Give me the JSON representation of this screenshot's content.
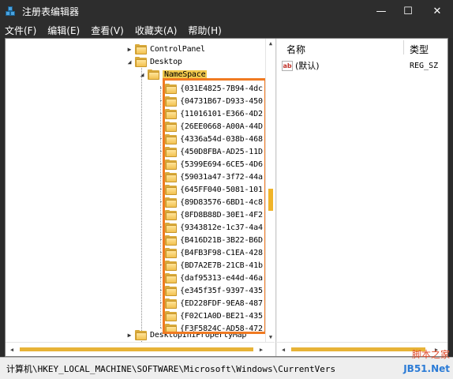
{
  "window": {
    "title": "注册表编辑器",
    "minimize": "—",
    "maximize": "☐",
    "close": "✕"
  },
  "menu": [
    "文件(F)",
    "编辑(E)",
    "查看(V)",
    "收藏夹(A)",
    "帮助(H)"
  ],
  "tree": {
    "parents": [
      {
        "label": "ControlPanel",
        "expander": "▶"
      },
      {
        "label": "Desktop",
        "expander": "◢"
      },
      {
        "label": "NameSpace",
        "expander": "◢"
      }
    ],
    "children": [
      "{031E4825-7B94-4dc",
      "{04731B67-D933-450",
      "{11016101-E366-4D2",
      "{26EE0668-A00A-44D",
      "{4336a54d-038b-468",
      "{450D8FBA-AD25-11D",
      "{5399E694-6CE5-4D6",
      "{59031a47-3f72-44a",
      "{645FF040-5081-101",
      "{89D83576-6BD1-4c8",
      "{8FD8B88D-30E1-4F2",
      "{9343812e-1c37-4a4",
      "{B416D21B-3B22-B6D",
      "{B4FB3F98-C1EA-428",
      "{BD7A2E7B-21CB-41b",
      "{daf95313-e44d-46a",
      "{e345f35f-9397-435",
      "{ED228FDF-9EA8-487",
      "{F02C1A0D-BE21-435",
      "{F3F5824C-AD58-472"
    ],
    "next_sibling": {
      "label": "DesktopIniPropertyMap",
      "expander": "▶"
    }
  },
  "list": {
    "col_name": "名称",
    "col_type": "类型",
    "rows": [
      {
        "icon": "ab",
        "name": "(默认)",
        "type": "REG_SZ"
      }
    ]
  },
  "status": {
    "path": "计算机\\HKEY_LOCAL_MACHINE\\SOFTWARE\\Microsoft\\Windows\\CurrentVers"
  },
  "watermark": {
    "line1": "脚本之家",
    "line2": "JB51.Net"
  },
  "colors": {
    "highlight_border": "#f07a22",
    "selected_bg": "#f2c94c",
    "scroll_thumb": "#e7b337"
  }
}
